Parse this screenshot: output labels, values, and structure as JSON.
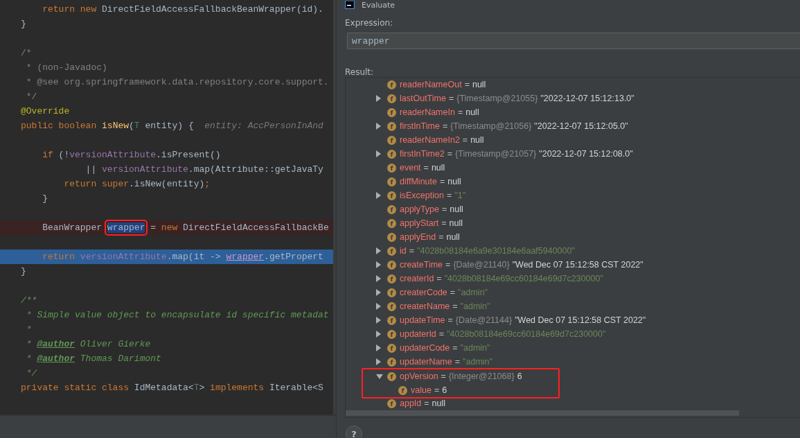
{
  "editor": {
    "lines": [
      {
        "kind": "code",
        "tokens": [
          {
            "kind": "keyword",
            "text": "    return new "
          },
          {
            "kind": "plain",
            "text": "DirectFieldAccessFallbackBeanWrapper(id)."
          }
        ]
      },
      {
        "kind": "code",
        "tokens": [
          {
            "kind": "plain",
            "text": "}"
          }
        ]
      },
      {
        "kind": "blank"
      },
      {
        "kind": "code",
        "tokens": [
          {
            "kind": "comment",
            "text": "/*"
          }
        ]
      },
      {
        "kind": "code",
        "tokens": [
          {
            "kind": "comment",
            "text": " * (non-Javadoc)"
          }
        ]
      },
      {
        "kind": "code",
        "tokens": [
          {
            "kind": "comment",
            "text": " * @see org.springframework.data.repository.core.support."
          }
        ]
      },
      {
        "kind": "code",
        "tokens": [
          {
            "kind": "comment",
            "text": " */"
          }
        ]
      },
      {
        "kind": "code",
        "tokens": [
          {
            "kind": "annotation",
            "text": "@Override"
          }
        ]
      },
      {
        "kind": "code",
        "tokens": [
          {
            "kind": "keyword",
            "text": "public boolean "
          },
          {
            "kind": "method",
            "text": "isNew"
          },
          {
            "kind": "plain",
            "text": "("
          },
          {
            "kind": "typeparam",
            "text": "T"
          },
          {
            "kind": "plain",
            "text": " entity) {  "
          },
          {
            "kind": "hint",
            "text": "entity: AccPersonInAnd"
          }
        ]
      },
      {
        "kind": "blank"
      },
      {
        "kind": "code",
        "tokens": [
          {
            "kind": "keyword",
            "text": "    if "
          },
          {
            "kind": "plain",
            "text": "(!"
          },
          {
            "kind": "field",
            "text": "versionAttribute"
          },
          {
            "kind": "plain",
            "text": ".isPresent()"
          }
        ]
      },
      {
        "kind": "code",
        "tokens": [
          {
            "kind": "plain",
            "text": "            || "
          },
          {
            "kind": "field",
            "text": "versionAttribute"
          },
          {
            "kind": "plain",
            "text": ".map(Attribute::getJavaTy"
          }
        ]
      },
      {
        "kind": "code",
        "tokens": [
          {
            "kind": "keyword",
            "text": "        return super"
          },
          {
            "kind": "plain",
            "text": ".isNew(entity)"
          },
          {
            "kind": "keyword",
            "text": ";"
          }
        ]
      },
      {
        "kind": "code",
        "tokens": [
          {
            "kind": "plain",
            "text": "    }"
          }
        ]
      },
      {
        "kind": "blank"
      },
      {
        "kind": "breakpoint",
        "tokens": [
          {
            "kind": "plain",
            "text": "    BeanWrapper "
          },
          {
            "kind": "selected",
            "text": "wrapper",
            "boxed": true
          },
          {
            "kind": "plain",
            "text": " = "
          },
          {
            "kind": "keyword",
            "text": "new "
          },
          {
            "kind": "plain",
            "text": "DirectFieldAccessFallbackBe"
          }
        ]
      },
      {
        "kind": "blank"
      },
      {
        "kind": "current",
        "tokens": [
          {
            "kind": "keyword",
            "text": "    return "
          },
          {
            "kind": "field",
            "text": "versionAttribute"
          },
          {
            "kind": "plain",
            "text": ".map(it -> "
          },
          {
            "kind": "usage",
            "text": "wrapper"
          },
          {
            "kind": "plain",
            "text": ".getPropert"
          }
        ]
      },
      {
        "kind": "code",
        "tokens": [
          {
            "kind": "plain",
            "text": "}"
          }
        ]
      },
      {
        "kind": "blank"
      },
      {
        "kind": "code",
        "tokens": [
          {
            "kind": "doc",
            "text": "/**"
          }
        ]
      },
      {
        "kind": "code",
        "tokens": [
          {
            "kind": "doc",
            "text": " * Simple value object to encapsulate id specific metadat"
          }
        ]
      },
      {
        "kind": "code",
        "tokens": [
          {
            "kind": "doc",
            "text": " *"
          }
        ]
      },
      {
        "kind": "code",
        "tokens": [
          {
            "kind": "doc",
            "text": " * "
          },
          {
            "kind": "doctag",
            "text": "@author"
          },
          {
            "kind": "doc",
            "text": " Oliver Gierke"
          }
        ]
      },
      {
        "kind": "code",
        "tokens": [
          {
            "kind": "doc",
            "text": " * "
          },
          {
            "kind": "doctag",
            "text": "@author"
          },
          {
            "kind": "doc",
            "text": " Thomas Darimont"
          }
        ]
      },
      {
        "kind": "code",
        "tokens": [
          {
            "kind": "doc",
            "text": " */"
          }
        ]
      },
      {
        "kind": "code",
        "tokens": [
          {
            "kind": "keyword",
            "text": "private static class "
          },
          {
            "kind": "plain",
            "text": "IdMetadata<"
          },
          {
            "kind": "typeparam",
            "text": "T"
          },
          {
            "kind": "plain",
            "text": "> "
          },
          {
            "kind": "keyword",
            "text": "implements "
          },
          {
            "kind": "plain",
            "text": "Iterable<S"
          }
        ]
      }
    ]
  },
  "dialog": {
    "title": "Evaluate",
    "expression_label": "Expression:",
    "expression": "wrapper",
    "result_label": "Result:",
    "help": "?",
    "tree": [
      {
        "kind": "leaf",
        "icon": "f",
        "name": "readerNameOut",
        "sep": "=",
        "value": "null",
        "value_is_string": false
      },
      {
        "kind": "object",
        "expanded": false,
        "icon": "f",
        "name": "lastOutTime",
        "sep": "=",
        "type": "{Timestamp@21055}",
        "value": "\"2022-12-07 15:12:13.0\"",
        "value_is_string": false
      },
      {
        "kind": "leaf",
        "icon": "f",
        "name": "readerNameIn",
        "sep": "=",
        "value": "null",
        "value_is_string": false
      },
      {
        "kind": "object",
        "expanded": false,
        "icon": "f",
        "name": "firstInTime",
        "sep": "=",
        "type": "{Timestamp@21056}",
        "value": "\"2022-12-07 15:12:05.0\"",
        "value_is_string": false
      },
      {
        "kind": "leaf",
        "icon": "f",
        "name": "readerNameIn2",
        "sep": "=",
        "value": "null",
        "value_is_string": false
      },
      {
        "kind": "object",
        "expanded": false,
        "icon": "f",
        "name": "firstInTime2",
        "sep": "=",
        "type": "{Timestamp@21057}",
        "value": "\"2022-12-07 15:12:08.0\"",
        "value_is_string": false
      },
      {
        "kind": "leaf",
        "icon": "f",
        "name": "event",
        "sep": "=",
        "value": "null",
        "value_is_string": false
      },
      {
        "kind": "leaf",
        "icon": "f",
        "name": "diffMinute",
        "sep": "=",
        "value": "null",
        "value_is_string": false
      },
      {
        "kind": "object",
        "expanded": false,
        "icon": "f",
        "name": "isException",
        "sep": "=",
        "value": "\"1\"",
        "value_is_string": true
      },
      {
        "kind": "leaf",
        "icon": "f",
        "name": "applyType",
        "sep": "=",
        "value": "null",
        "value_is_string": false
      },
      {
        "kind": "leaf",
        "icon": "f",
        "name": "applyStart",
        "sep": "=",
        "value": "null",
        "value_is_string": false
      },
      {
        "kind": "leaf",
        "icon": "f",
        "name": "applyEnd",
        "sep": "=",
        "value": "null",
        "value_is_string": false
      },
      {
        "kind": "object",
        "expanded": false,
        "icon": "f",
        "name": "id",
        "sep": "=",
        "value": "\"4028b08184e6a9e30184e6aaf5940000\"",
        "value_is_string": true
      },
      {
        "kind": "object",
        "expanded": false,
        "icon": "f",
        "name": "createTime",
        "sep": "=",
        "type": "{Date@21140}",
        "value": "\"Wed Dec 07 15:12:58 CST 2022\"",
        "value_is_string": false
      },
      {
        "kind": "object",
        "expanded": false,
        "icon": "f",
        "name": "createrId",
        "sep": "=",
        "value": "\"4028b08184e69cc60184e69d7c230000\"",
        "value_is_string": true
      },
      {
        "kind": "object",
        "expanded": false,
        "icon": "f",
        "name": "createrCode",
        "sep": "=",
        "value": "\"admin\"",
        "value_is_string": true
      },
      {
        "kind": "object",
        "expanded": false,
        "icon": "f",
        "name": "createrName",
        "sep": "=",
        "value": "\"admin\"",
        "value_is_string": true
      },
      {
        "kind": "object",
        "expanded": false,
        "icon": "f",
        "name": "updateTime",
        "sep": "=",
        "type": "{Date@21144}",
        "value": "\"Wed Dec 07 15:12:58 CST 2022\"",
        "value_is_string": false
      },
      {
        "kind": "object",
        "expanded": false,
        "icon": "f",
        "name": "updaterId",
        "sep": "=",
        "value": "\"4028b08184e69cc60184e69d7c230000\"",
        "value_is_string": true
      },
      {
        "kind": "object",
        "expanded": false,
        "icon": "f",
        "name": "updaterCode",
        "sep": "=",
        "value": "\"admin\"",
        "value_is_string": true
      },
      {
        "kind": "object",
        "expanded": false,
        "icon": "f",
        "name": "updaterName",
        "sep": "=",
        "value": "\"admin\"",
        "value_is_string": true
      },
      {
        "kind": "object",
        "expanded": true,
        "boxed": true,
        "icon": "f",
        "name": "opVersion",
        "sep": "=",
        "type": "{Integer@21068}",
        "value": "6",
        "value_is_string": false,
        "children": [
          {
            "icon": "f",
            "name": "value",
            "sep": "=",
            "value": "6",
            "value_is_string": false
          }
        ]
      },
      {
        "kind": "leaf",
        "icon": "f",
        "name": "appId",
        "sep": "=",
        "value": "null",
        "value_is_string": false
      }
    ]
  }
}
